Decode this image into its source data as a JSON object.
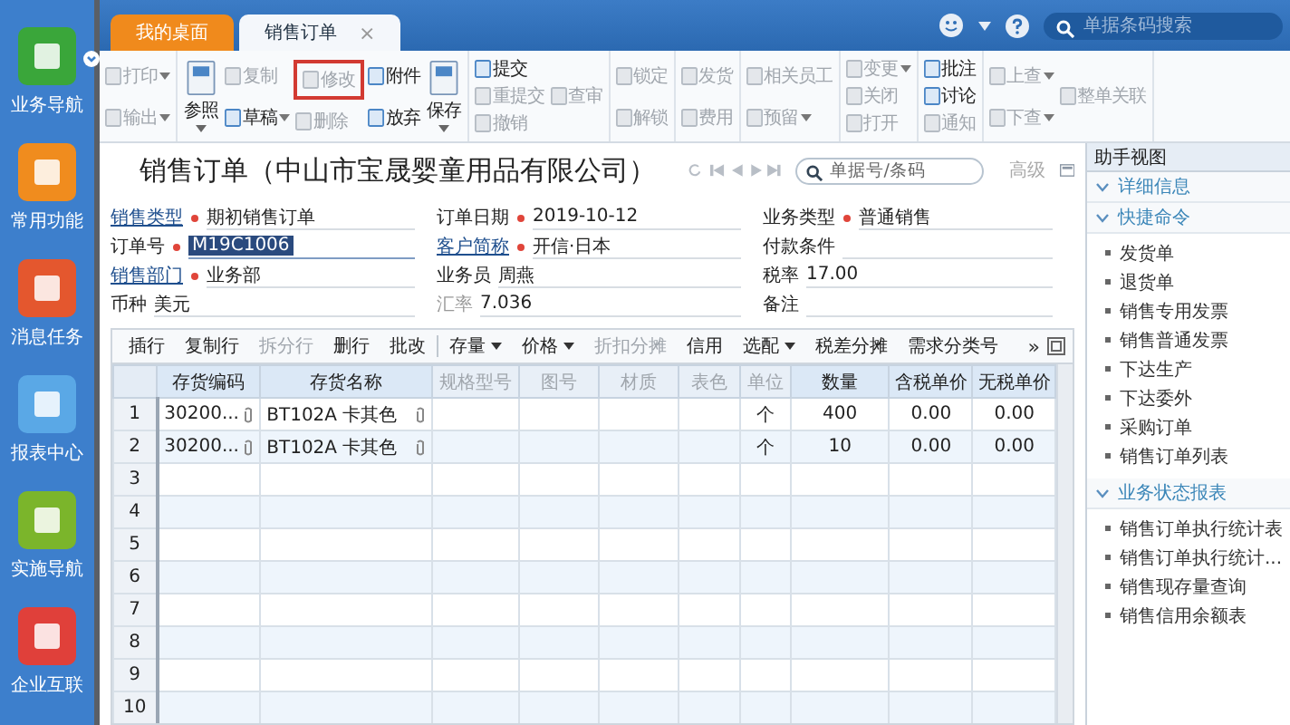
{
  "sidebar": {
    "items": [
      {
        "label": "业务导航",
        "color": "#3aa63a",
        "dropdown": true
      },
      {
        "label": "常用功能",
        "color": "#f08c1e",
        "dropdown": false
      },
      {
        "label": "消息任务",
        "color": "#e4572e",
        "dropdown": false
      },
      {
        "label": "报表中心",
        "color": "#5aa8e6",
        "dropdown": false
      },
      {
        "label": "实施导航",
        "color": "#7bb52b",
        "dropdown": false
      },
      {
        "label": "企业互联",
        "color": "#e0403a",
        "dropdown": false
      }
    ]
  },
  "tabs": [
    {
      "label": "我的桌面",
      "selected": false
    },
    {
      "label": "销售订单",
      "selected": true,
      "close": "×"
    }
  ],
  "header_search": {
    "placeholder": "单据条码搜索"
  },
  "toolbar": {
    "groups": [
      {
        "columns": [
          {
            "kind": "stack",
            "items": [
              {
                "label": "打印",
                "disabled": true,
                "caret": true,
                "highlighted": false
              },
              {
                "label": "输出",
                "disabled": true,
                "caret": true,
                "highlighted": false
              }
            ]
          }
        ]
      },
      {
        "columns": [
          {
            "kind": "large",
            "items": [
              {
                "label": "参照",
                "disabled": false,
                "caret": true,
                "highlighted": false
              }
            ]
          },
          {
            "kind": "stack",
            "items": [
              {
                "label": "复制",
                "disabled": true,
                "caret": false,
                "highlighted": false
              },
              {
                "label": "草稿",
                "disabled": false,
                "caret": true,
                "highlighted": false
              }
            ]
          },
          {
            "kind": "stack",
            "items": [
              {
                "label": "修改",
                "disabled": true,
                "caret": false,
                "highlighted": true
              },
              {
                "label": "删除",
                "disabled": true,
                "caret": false,
                "highlighted": false
              }
            ]
          },
          {
            "kind": "stack",
            "items": [
              {
                "label": "附件",
                "disabled": false,
                "caret": false,
                "highlighted": false
              },
              {
                "label": "放弃",
                "disabled": false,
                "caret": false,
                "highlighted": false
              }
            ]
          },
          {
            "kind": "large",
            "items": [
              {
                "label": "保存",
                "disabled": false,
                "caret": true,
                "highlighted": false
              }
            ]
          }
        ]
      },
      {
        "columns": [
          {
            "kind": "stack",
            "items": [
              {
                "label": "提交",
                "disabled": false,
                "caret": false,
                "highlighted": false
              },
              {
                "label": "重提交",
                "disabled": true,
                "caret": false,
                "highlighted": false
              },
              {
                "label": "撤销",
                "disabled": true,
                "caret": false,
                "highlighted": false
              }
            ]
          },
          {
            "kind": "stack",
            "items": [
              {
                "label": "查审",
                "disabled": true,
                "caret": false,
                "highlighted": false
              }
            ]
          }
        ]
      },
      {
        "columns": [
          {
            "kind": "stack",
            "items": [
              {
                "label": "锁定",
                "disabled": true,
                "caret": false,
                "highlighted": false
              },
              {
                "label": "解锁",
                "disabled": true,
                "caret": false,
                "highlighted": false
              }
            ]
          }
        ]
      },
      {
        "columns": [
          {
            "kind": "stack",
            "items": [
              {
                "label": "发货",
                "disabled": true,
                "caret": false,
                "highlighted": false
              },
              {
                "label": "费用",
                "disabled": true,
                "caret": false,
                "highlighted": false
              }
            ]
          }
        ]
      },
      {
        "columns": [
          {
            "kind": "stack",
            "items": [
              {
                "label": "相关员工",
                "disabled": true,
                "caret": false,
                "highlighted": false
              },
              {
                "label": "预留",
                "disabled": true,
                "caret": true,
                "highlighted": false
              }
            ]
          }
        ]
      },
      {
        "columns": [
          {
            "kind": "stack",
            "items": [
              {
                "label": "变更",
                "disabled": true,
                "caret": true,
                "highlighted": false
              },
              {
                "label": "关闭",
                "disabled": true,
                "caret": false,
                "highlighted": false
              },
              {
                "label": "打开",
                "disabled": true,
                "caret": false,
                "highlighted": false
              }
            ]
          }
        ]
      },
      {
        "columns": [
          {
            "kind": "stack",
            "items": [
              {
                "label": "批注",
                "disabled": false,
                "caret": false,
                "highlighted": false
              },
              {
                "label": "讨论",
                "disabled": false,
                "caret": false,
                "highlighted": false
              },
              {
                "label": "通知",
                "disabled": true,
                "caret": false,
                "highlighted": false
              }
            ]
          }
        ]
      },
      {
        "columns": [
          {
            "kind": "stack",
            "items": [
              {
                "label": "上查",
                "disabled": true,
                "caret": true,
                "highlighted": false
              },
              {
                "label": "下查",
                "disabled": true,
                "caret": true,
                "highlighted": false
              }
            ]
          },
          {
            "kind": "stack",
            "items": [
              {
                "label": "整单关联",
                "disabled": true,
                "caret": false,
                "highlighted": false
              }
            ]
          }
        ]
      }
    ]
  },
  "document": {
    "title": "销售订单（中山市宝晟婴童用品有限公司）",
    "search": {
      "placeholder": "单据号/条码"
    },
    "advanced": "高级"
  },
  "form": {
    "fields": [
      {
        "label": "销售类型",
        "value": "期初销售订单",
        "required": true,
        "link": true,
        "disabled": false,
        "selected": false
      },
      {
        "label": "订单日期",
        "value": "2019-10-12",
        "required": true,
        "link": false,
        "disabled": false,
        "selected": false
      },
      {
        "label": "业务类型",
        "value": "普通销售",
        "required": true,
        "link": false,
        "disabled": false,
        "selected": false
      },
      {
        "label": "订单号",
        "value": "M19C1006",
        "required": true,
        "link": false,
        "disabled": false,
        "selected": true
      },
      {
        "label": "客户简称",
        "value": "开信·日本",
        "required": true,
        "link": true,
        "disabled": false,
        "selected": false
      },
      {
        "label": "付款条件",
        "required": false,
        "link": false,
        "disabled": false,
        "selected": false
      },
      {
        "label": "销售部门",
        "value": "业务部",
        "required": true,
        "link": true,
        "disabled": false,
        "selected": false
      },
      {
        "label": "业务员",
        "value": "周燕",
        "required": false,
        "link": false,
        "disabled": false,
        "selected": false
      },
      {
        "label": "税率",
        "value": "17.00",
        "required": false,
        "link": false,
        "disabled": false,
        "selected": false
      },
      {
        "label": "币种",
        "value": "美元",
        "required": false,
        "link": false,
        "disabled": false,
        "selected": false
      },
      {
        "label": "汇率",
        "value": "7.036",
        "required": false,
        "link": false,
        "disabled": true,
        "selected": false
      },
      {
        "label": "备注",
        "required": false,
        "link": false,
        "disabled": false,
        "selected": false
      }
    ]
  },
  "table_toolbar": {
    "groups": [
      [
        {
          "label": "插行",
          "disabled": false,
          "caret": false
        },
        {
          "label": "复制行",
          "disabled": false,
          "caret": false
        },
        {
          "label": "拆分行",
          "disabled": true,
          "caret": false
        },
        {
          "label": "删行",
          "disabled": false,
          "caret": false
        },
        {
          "label": "批改",
          "disabled": false,
          "caret": false
        }
      ],
      [
        {
          "label": "存量",
          "disabled": false,
          "caret": true
        },
        {
          "label": "价格",
          "disabled": false,
          "caret": true
        },
        {
          "label": "折扣分摊",
          "disabled": true,
          "caret": false
        },
        {
          "label": "信用",
          "disabled": false,
          "caret": false
        },
        {
          "label": "选配",
          "disabled": false,
          "caret": true
        },
        {
          "label": "税差分摊",
          "disabled": false,
          "caret": false
        },
        {
          "label": "需求分类号",
          "disabled": false,
          "caret": false
        }
      ]
    ],
    "more": "»"
  },
  "table": {
    "columns": [
      {
        "label": "存货编码",
        "disabled": false
      },
      {
        "label": "存货名称",
        "disabled": false
      },
      {
        "label": "规格型号",
        "disabled": true
      },
      {
        "label": "图号",
        "disabled": true
      },
      {
        "label": "材质",
        "disabled": true
      },
      {
        "label": "表色",
        "disabled": true
      },
      {
        "label": "单位",
        "disabled": true
      },
      {
        "label": "数量",
        "disabled": false
      },
      {
        "label": "含税单价",
        "disabled": false
      },
      {
        "label": "无税单价",
        "disabled": false
      }
    ],
    "rows": [
      {
        "number": "1",
        "code": "30200...",
        "name": "BT102A 卡其色",
        "unit": "个",
        "quantity": "400",
        "price_with_tax": "0.00",
        "price_without_tax": "0.00"
      },
      {
        "number": "2",
        "code": "30200...",
        "name": "BT102A 卡其色",
        "unit": "个",
        "quantity": "10",
        "price_with_tax": "0.00",
        "price_without_tax": "0.00"
      },
      {
        "number": "3"
      },
      {
        "number": "4"
      },
      {
        "number": "5"
      },
      {
        "number": "6"
      },
      {
        "number": "7"
      },
      {
        "number": "8"
      },
      {
        "number": "9"
      },
      {
        "number": "10"
      }
    ]
  },
  "assistant": {
    "title": "助手视图",
    "sections": [
      {
        "title": "详细信息"
      },
      {
        "title": "快捷命令",
        "items": [
          "发货单",
          "退货单",
          "销售专用发票",
          "销售普通发票",
          "下达生产",
          "下达委外",
          "采购订单",
          "销售订单列表"
        ]
      },
      {
        "title": "业务状态报表",
        "items": [
          "销售订单执行统计表",
          "销售订单执行统计...",
          "销售现存量查询",
          "销售信用余额表"
        ]
      }
    ]
  }
}
